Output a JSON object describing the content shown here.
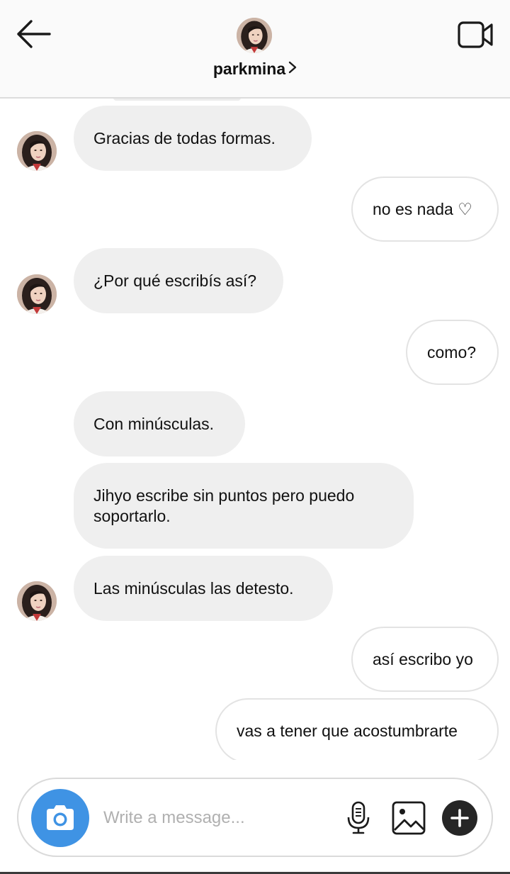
{
  "header": {
    "username": "parkmina",
    "back_icon": "arrow-left-icon",
    "video_icon": "video-camera-icon",
    "chevron_icon": "chevron-right-icon"
  },
  "messages": [
    {
      "direction": "incoming",
      "text": "Gracias de todas formas.",
      "avatar": true
    },
    {
      "direction": "outgoing",
      "text": "no es nada ♡"
    },
    {
      "direction": "incoming",
      "text": "¿Por qué escribís así?",
      "avatar": true
    },
    {
      "direction": "outgoing",
      "text": "como?"
    },
    {
      "direction": "incoming",
      "text": "Con minúsculas.",
      "avatar": false
    },
    {
      "direction": "incoming",
      "text": "Jihyo escribe sin puntos pero puedo soportarlo.",
      "avatar": false
    },
    {
      "direction": "incoming",
      "text": "Las minúsculas las detesto.",
      "avatar": true
    },
    {
      "direction": "outgoing",
      "text": "así escribo yo"
    },
    {
      "direction": "outgoing",
      "text": "vas a tener que acostumbrarte"
    }
  ],
  "composer": {
    "placeholder": "Write a message...",
    "value": "",
    "camera_icon": "camera-icon",
    "mic_icon": "microphone-icon",
    "gallery_icon": "gallery-icon",
    "plus_icon": "plus-icon"
  },
  "colors": {
    "accent_blue": "#3f93e4",
    "incoming_bubble": "#efefef",
    "outgoing_border": "#e3e3e3",
    "header_bg": "#fafafa",
    "plus_button": "#262626"
  }
}
